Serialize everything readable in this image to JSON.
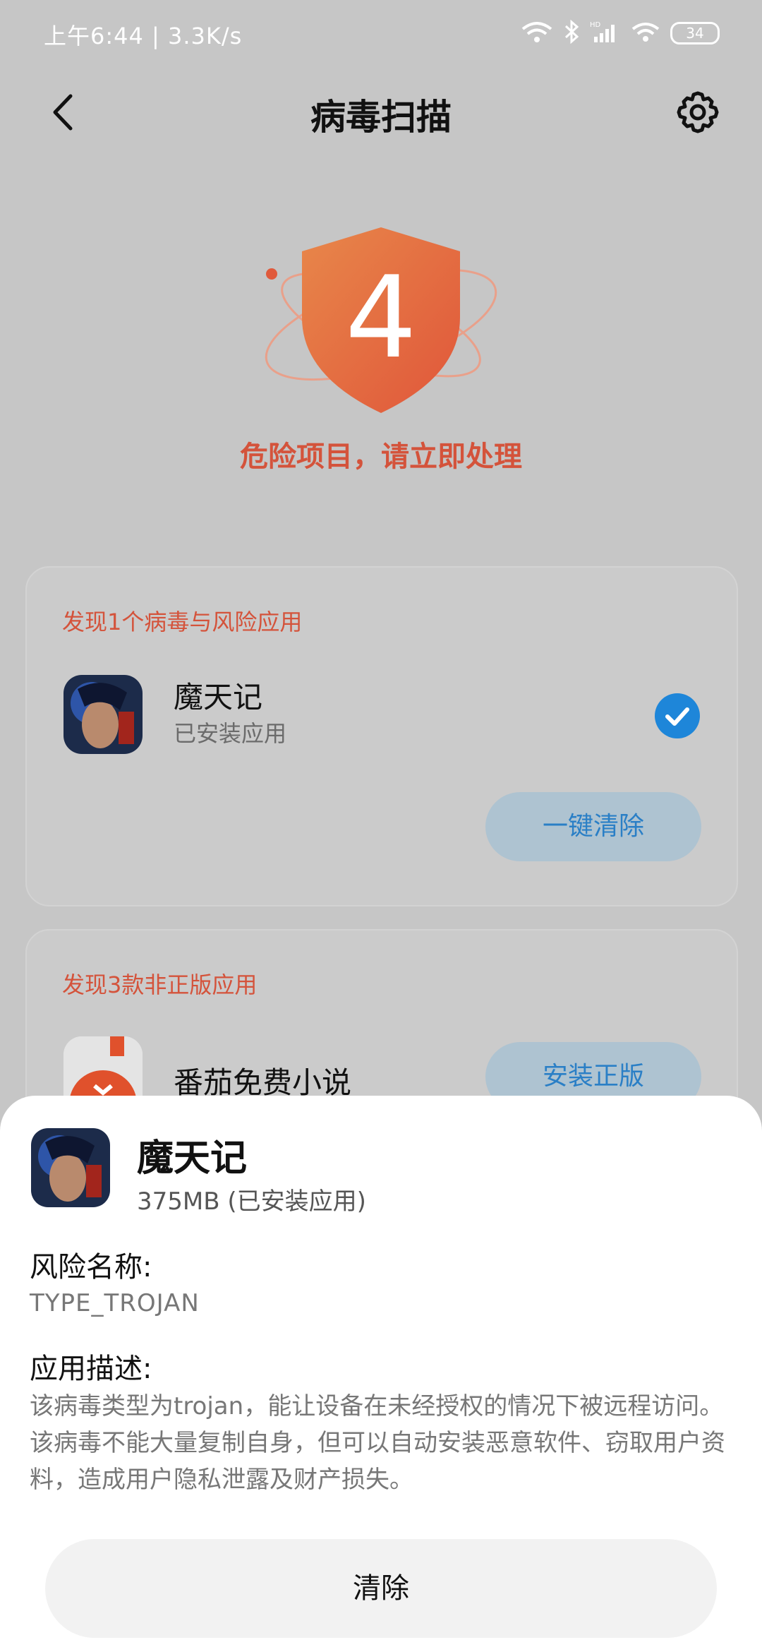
{
  "status_bar": {
    "time": "上午6:44 | 3.3K/s",
    "icons": [
      "wifi-icon",
      "bluetooth-icon",
      "hd-signal-icon",
      "wifi-icon"
    ],
    "battery": "34"
  },
  "header": {
    "title": "病毒扫描",
    "back_icon": "back-arrow-icon",
    "settings_icon": "gear-icon"
  },
  "hero": {
    "count": "4",
    "message": "危险项目，请立即处理",
    "accent_color": "#d4533b"
  },
  "card_virus": {
    "title": "发现1个病毒与风险应用",
    "app_name": "魔天记",
    "app_status": "已安装应用",
    "checked": true,
    "action": "一键清除"
  },
  "card_pirate": {
    "title": "发现3款非正版应用",
    "app_name": "番茄免费小说",
    "action": "安装正版"
  },
  "sheet": {
    "app_name": "魔天记",
    "app_meta": "375MB (已安装应用)",
    "risk_label": "风险名称:",
    "risk_value": "TYPE_TROJAN",
    "desc_label": "应用描述:",
    "desc_text": "该病毒类型为trojan，能让设备在未经授权的情况下被远程访问。该病毒不能大量复制自身，但可以自动安装恶意软件、窃取用户资料，造成用户隐私泄露及财产损失。",
    "button": "清除"
  }
}
